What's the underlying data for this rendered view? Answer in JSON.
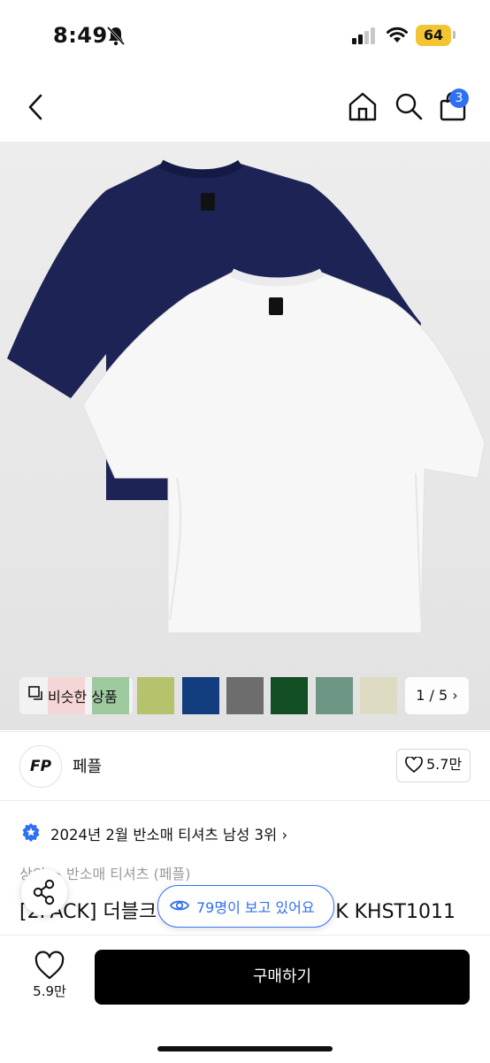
{
  "status_bar": {
    "time": "8:49",
    "battery": "64"
  },
  "nav": {
    "cart_count": "3"
  },
  "swatches": {
    "similar_label": "비슷한 상품",
    "colors": [
      "#e9a5a5",
      "#2c8a2e",
      "#b6c26c",
      "#123d7f",
      "#6d6d6d",
      "#124e24",
      "#6d9684",
      "#dddbc2"
    ],
    "pager": "1 / 5"
  },
  "seller": {
    "logo_text": "FP",
    "name": "페플",
    "likes": "5.7만"
  },
  "ranking": {
    "text": "2024년 2월 반소매 티셔츠 남성 3위"
  },
  "product": {
    "category_prefix": "상의",
    "category_sep": ">",
    "category_name": "반소매 티셔츠 (페플)",
    "title_start": "[2PACK] 더블크",
    "title_end": "K KHST1011"
  },
  "viewers": {
    "text": "79명이 보고 있어요"
  },
  "bottom": {
    "like_count": "5.9만",
    "buy_label": "구매하기"
  },
  "colors": {
    "accent": "#2f6ff3",
    "buy_bg": "#000000",
    "navy_shirt": "#1d2455",
    "white_shirt": "#f7f7f8"
  }
}
